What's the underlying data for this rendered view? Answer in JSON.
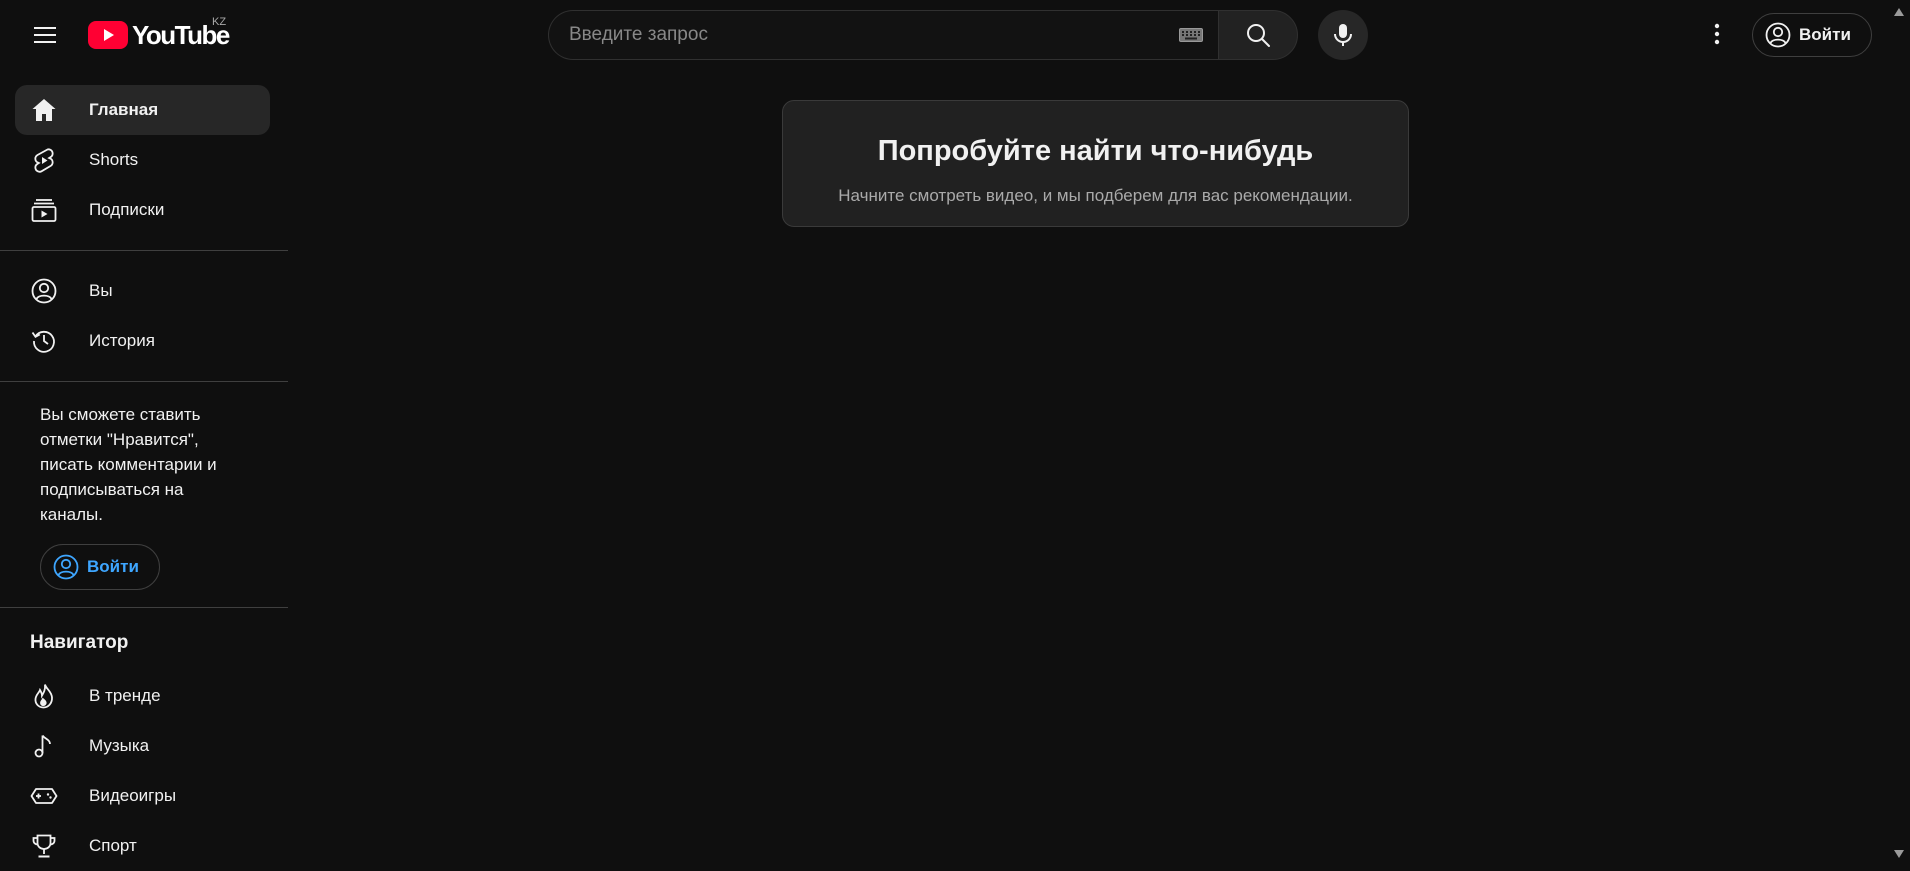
{
  "header": {
    "logo_text": "YouTube",
    "country_code": "KZ",
    "search_placeholder": "Введите запрос",
    "signin_label": "Войти"
  },
  "sidebar": {
    "primary": [
      {
        "label": "Главная",
        "icon": "home-icon",
        "active": true
      },
      {
        "label": "Shorts",
        "icon": "shorts-icon",
        "active": false
      },
      {
        "label": "Подписки",
        "icon": "subscriptions-icon",
        "active": false
      }
    ],
    "you": [
      {
        "label": "Вы",
        "icon": "account-circle-icon"
      },
      {
        "label": "История",
        "icon": "history-icon"
      }
    ],
    "signin_promo": "Вы сможете ставить отметки \"Нравится\", писать комментарии и подписываться на каналы.",
    "signin_label": "Войти",
    "navigator_title": "Навигатор",
    "navigator": [
      {
        "label": "В тренде",
        "icon": "trending-flame-icon"
      },
      {
        "label": "Музыка",
        "icon": "music-note-icon"
      },
      {
        "label": "Видеоигры",
        "icon": "gamepad-icon"
      },
      {
        "label": "Спорт",
        "icon": "trophy-icon"
      }
    ]
  },
  "main": {
    "empty_title": "Попробуйте найти что-нибудь",
    "empty_subtitle": "Начните смотреть видео, и мы подберем для вас рекомендации."
  },
  "colors": {
    "background": "#0f0f0f",
    "brand_red": "#ff0033",
    "link_blue": "#3ea6ff",
    "active_item": "#272727"
  }
}
